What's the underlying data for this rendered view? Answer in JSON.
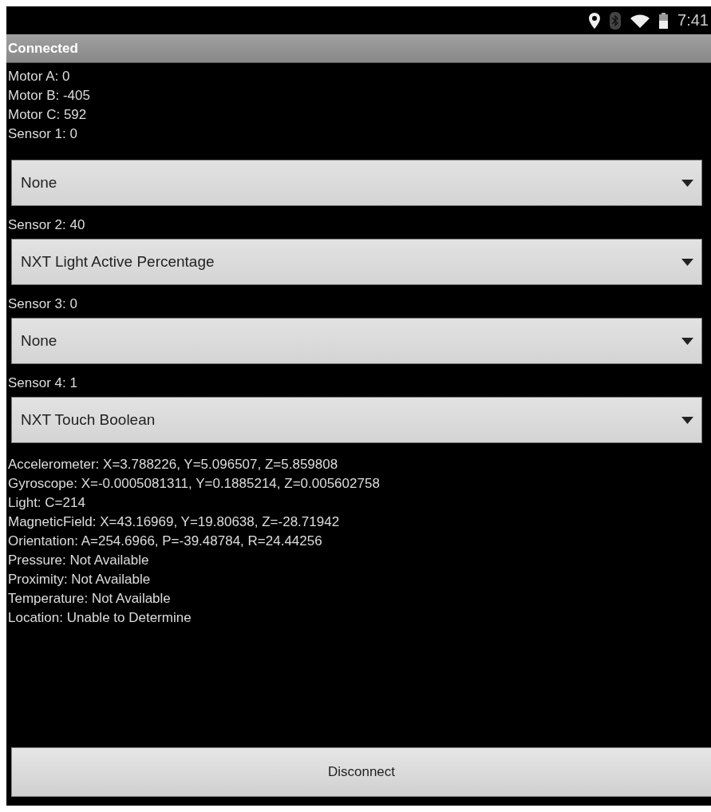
{
  "status_bar": {
    "time": "7:41"
  },
  "title": "Connected",
  "motors": [
    "Motor A: 0",
    "Motor B: -405",
    "Motor C: 592"
  ],
  "sensors": [
    {
      "label": "Sensor 1: 0",
      "selection": "None"
    },
    {
      "label": "Sensor 2: 40",
      "selection": "NXT Light Active Percentage"
    },
    {
      "label": "Sensor 3: 0",
      "selection": "None"
    },
    {
      "label": "Sensor 4: 1",
      "selection": "NXT Touch Boolean"
    }
  ],
  "readings": [
    "Accelerometer: X=3.788226, Y=5.096507, Z=5.859808",
    "Gyroscope: X=-0.0005081311, Y=0.1885214, Z=0.005602758",
    "Light: C=214",
    "MagneticField: X=43.16969, Y=19.80638, Z=-28.71942",
    "Orientation: A=254.6966, P=-39.48784, R=24.44256",
    "Pressure: Not Available",
    "Proximity: Not Available",
    "Temperature: Not Available",
    "Location: Unable to Determine"
  ],
  "buttons": [
    "Disconnect"
  ]
}
